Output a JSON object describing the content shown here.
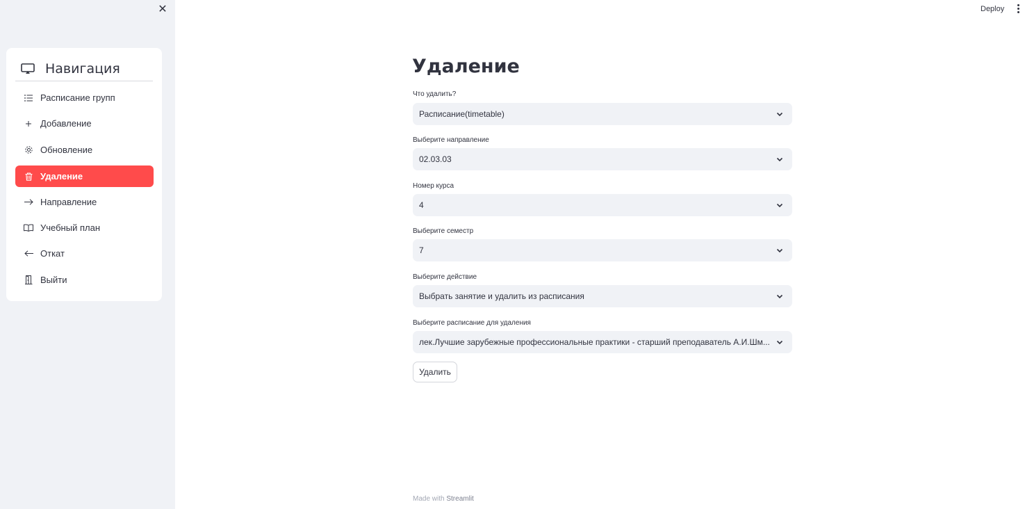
{
  "header": {
    "deploy_label": "Deploy"
  },
  "sidebar": {
    "title": "Навигация",
    "items": [
      {
        "label": "Расписание групп",
        "icon": "list-icon",
        "active": false
      },
      {
        "label": "Добавление",
        "icon": "plus-icon",
        "active": false
      },
      {
        "label": "Обновление",
        "icon": "gear-icon",
        "active": false
      },
      {
        "label": "Удаление",
        "icon": "trash-icon",
        "active": true
      },
      {
        "label": "Направление",
        "icon": "arrow-right-icon",
        "active": false
      },
      {
        "label": "Учебный план",
        "icon": "book-icon",
        "active": false
      },
      {
        "label": "Откат",
        "icon": "arrow-left-icon",
        "active": false
      },
      {
        "label": "Выйти",
        "icon": "door-icon",
        "active": false
      }
    ],
    "accent_color": "#ff4b4b"
  },
  "main": {
    "title": "Удаление",
    "fields": [
      {
        "label": "Что удалить?",
        "value": "Расписание(timetable)"
      },
      {
        "label": "Выберите направление",
        "value": "02.03.03"
      },
      {
        "label": "Номер курса",
        "value": "4"
      },
      {
        "label": "Выберите семестр",
        "value": "7"
      },
      {
        "label": "Выберите действие",
        "value": "Выбрать занятие и удалить из расписания"
      },
      {
        "label": "Выберите расписание для удаления",
        "value": "лек.Лучшие зарубежные профессиональные практики - старший преподаватель А.И.Шм..."
      }
    ],
    "delete_button": "Удалить"
  },
  "footer": {
    "made_with": "Made with",
    "brand": "Streamlit"
  }
}
